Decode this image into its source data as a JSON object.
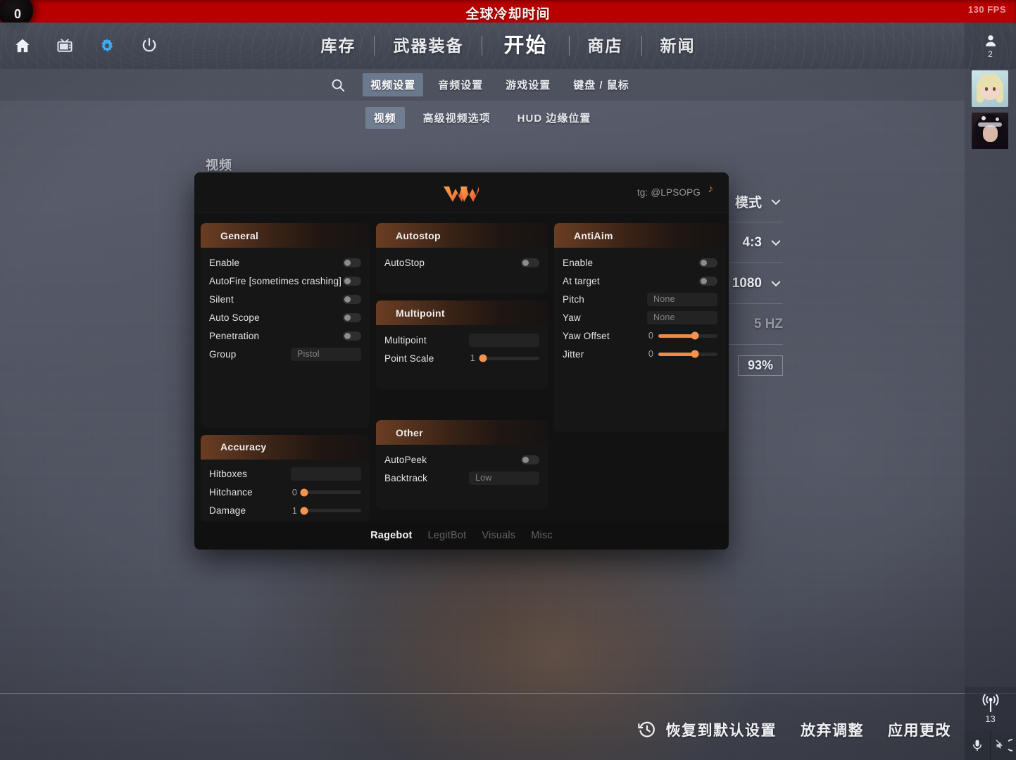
{
  "topbar": {
    "cooldown_title": "全球冷却时间",
    "cooldown_value": "0",
    "fps": "130 FPS"
  },
  "nav": {
    "icons": [
      "home-icon",
      "tv-icon",
      "gear-icon",
      "power-icon"
    ],
    "items": [
      {
        "label": "库存",
        "active": false
      },
      {
        "label": "武器装备",
        "active": false
      },
      {
        "label": "开始",
        "active": true
      },
      {
        "label": "商店",
        "active": false
      },
      {
        "label": "新闻",
        "active": false
      }
    ],
    "profile_count": "2"
  },
  "settings": {
    "search_icon": "search-icon",
    "tabs": [
      {
        "label": "视频设置",
        "active": true
      },
      {
        "label": "音频设置",
        "active": false
      },
      {
        "label": "游戏设置",
        "active": false
      },
      {
        "label": "键盘 / 鼠标",
        "active": false
      }
    ],
    "subtabs": [
      {
        "label": "视频",
        "active": true
      },
      {
        "label": "高级视频选项",
        "active": false
      },
      {
        "label": "HUD 边缘位置",
        "active": false
      }
    ],
    "section_label": "视频",
    "rows": [
      {
        "value": "模式",
        "chevron": true,
        "dim": false
      },
      {
        "value": "4:3",
        "chevron": true,
        "dim": false
      },
      {
        "value": "1080",
        "chevron": true,
        "dim": false
      },
      {
        "value": "5 HZ",
        "chevron": false,
        "dim": true
      },
      {
        "value": "93%",
        "chevron": false,
        "dim": false,
        "boxed": true
      }
    ]
  },
  "bottom_actions": {
    "restore_icon": "restore-clock-icon",
    "items": [
      "恢复到默认设置",
      "放弃调整",
      "应用更改"
    ]
  },
  "rail": {
    "ping": "13",
    "mic_icon": "microphone-icon",
    "headset_icon": "headset-mute-icon"
  },
  "cheat": {
    "logo": "w-logo-icon",
    "telegram": "tg: @LPSOPG",
    "note_icon": "music-note-icon",
    "groups": [
      {
        "title": "General",
        "column": 1,
        "rows": [
          {
            "label": "Enable",
            "type": "toggle",
            "on": false
          },
          {
            "label": "AutoFire [sometimes crashing]",
            "type": "toggle",
            "on": false
          },
          {
            "label": "Silent",
            "type": "toggle",
            "on": false
          },
          {
            "label": "Auto Scope",
            "type": "toggle",
            "on": false
          },
          {
            "label": "Penetration",
            "type": "toggle",
            "on": false
          },
          {
            "label": "Group",
            "type": "combo",
            "value": "Pistol"
          }
        ]
      },
      {
        "title": "Accuracy",
        "column": 1,
        "rows": [
          {
            "label": "Hitboxes",
            "type": "combo",
            "value": ""
          },
          {
            "label": "Hitchance",
            "type": "slider",
            "value": "0",
            "percent": 4
          },
          {
            "label": "Damage",
            "type": "slider",
            "value": "1",
            "percent": 4
          }
        ]
      },
      {
        "title": "Autostop",
        "column": 2,
        "rows": [
          {
            "label": "AutoStop",
            "type": "toggle",
            "on": false
          }
        ]
      },
      {
        "title": "Multipoint",
        "column": 2,
        "rows": [
          {
            "label": "Multipoint",
            "type": "combo",
            "value": ""
          },
          {
            "label": "Point Scale",
            "type": "slider",
            "value": "1",
            "percent": 5
          }
        ]
      },
      {
        "title": "Other",
        "column": 2,
        "rows": [
          {
            "label": "AutoPeek",
            "type": "toggle",
            "on": false
          },
          {
            "label": "Backtrack",
            "type": "combo",
            "value": "Low"
          }
        ]
      },
      {
        "title": "AntiAim",
        "column": 3,
        "rows": [
          {
            "label": "Enable",
            "type": "toggle",
            "on": false
          },
          {
            "label": "At target",
            "type": "toggle",
            "on": false
          },
          {
            "label": "Pitch",
            "type": "combo",
            "value": "None"
          },
          {
            "label": "Yaw",
            "type": "combo",
            "value": "None"
          },
          {
            "label": "Yaw Offset",
            "type": "slider",
            "value": "0",
            "percent": 62
          },
          {
            "label": "Jitter",
            "type": "slider",
            "value": "0",
            "percent": 62
          }
        ]
      }
    ],
    "tabs": [
      {
        "label": "Ragebot",
        "active": true
      },
      {
        "label": "LegitBot",
        "active": false
      },
      {
        "label": "Visuals",
        "active": false
      },
      {
        "label": "Misc",
        "active": false
      }
    ]
  },
  "colors": {
    "cooldown_red": "#b80000",
    "accent_orange": "#ef8a43",
    "group_header_brown": "#6b3d21",
    "tab_highlight": "rgba(150,175,205,.42)"
  }
}
